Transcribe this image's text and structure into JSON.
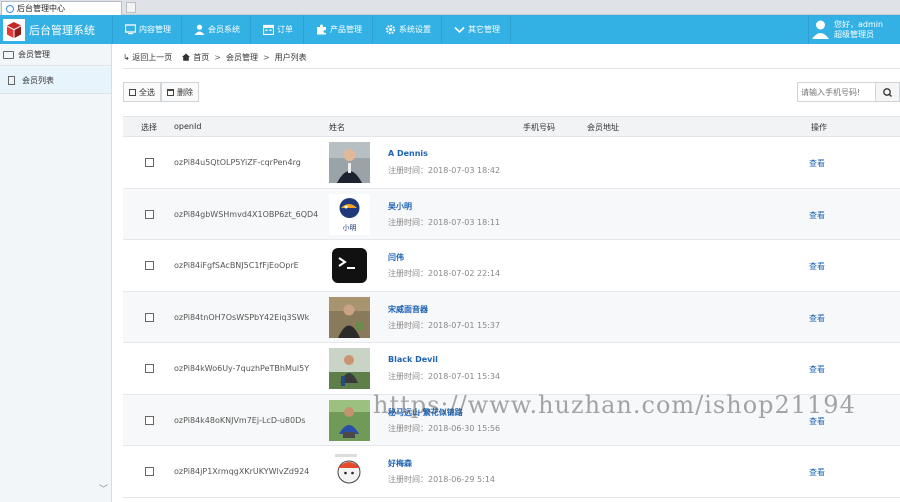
{
  "browser": {
    "tab_title": "后台管理中心"
  },
  "header": {
    "brand_title": "后台管理系统",
    "nav": [
      {
        "label": "内容管理",
        "icon": "monitor-icon"
      },
      {
        "label": "会员系统",
        "icon": "user-icon"
      },
      {
        "label": "订单",
        "icon": "calendar-icon"
      },
      {
        "label": "产品管理",
        "icon": "puzzle-icon"
      },
      {
        "label": "系统设置",
        "icon": "gear-icon"
      },
      {
        "label": "其它管理",
        "icon": "chevron-down-icon"
      }
    ],
    "user": {
      "greeting": "您好，admin",
      "role": "超级管理员"
    },
    "colors": {
      "bar": "#34b1e4",
      "link": "#1e63b4"
    }
  },
  "sidebar": {
    "section": "会员管理",
    "items": [
      {
        "label": "会员列表"
      }
    ]
  },
  "breadcrumb": {
    "back": "返回上一页",
    "home": "首页",
    "level1": "会员管理",
    "level2": "用户列表"
  },
  "toolbar": {
    "select_all": "全选",
    "delete": "删除"
  },
  "search": {
    "placeholder": "请输入手机号码!"
  },
  "table": {
    "headers": {
      "select": "选择",
      "openid": "openId",
      "name": "姓名",
      "phone": "手机号码",
      "address": "会员地址",
      "action": "操作"
    },
    "reg_prefix": "注册时间：",
    "view_label": "查看",
    "rows": [
      {
        "openid": "ozPi84u5QtOLP5YiZF-cqrPen4rg",
        "name": "A     Dennis",
        "reg": "注册时间：2018-07-03 18:42"
      },
      {
        "openid": "ozPi84gbWSHmvd4X1OBP6zt_6QD4",
        "name": "吴小明",
        "reg": "注册时间：2018-07-03 18:11"
      },
      {
        "openid": "ozPi84iFgfSAcBNJ5C1fFjEoOprE",
        "name": "闫伟",
        "reg": "注册时间：2018-07-02 22:14"
      },
      {
        "openid": "ozPi84tnOH7OsWSPbY42Eiq3SWk",
        "name": "宋威面音器",
        "reg": "注册时间：2018-07-01 15:37"
      },
      {
        "openid": "ozPi84kWo6Uy-7quzhPeTBhMul5Y",
        "name": "Black Devil",
        "reg": "注册时间：2018-07-01 15:34"
      },
      {
        "openid": "ozPi84k48oKNJVm7Ej-LcD-u80Ds",
        "name": "秘马远山 繁花似锦路",
        "reg": "注册时间：2018-06-30 15:56"
      },
      {
        "openid": "ozPi84jP1XrmqgXKrUKYWlvZd924",
        "name": "好梅森",
        "reg": "注册时间：2018-06-29 5:14"
      }
    ]
  },
  "watermark": "https://www.huzhan.com/ishop21194"
}
